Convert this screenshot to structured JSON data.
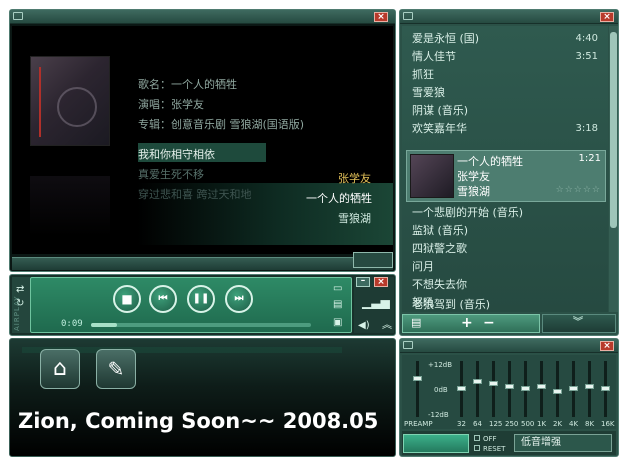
{
  "display": {
    "song_title": "歌名：一个人的牺牲",
    "singer": "演唱：张学友",
    "album": "专辑：创意音乐剧 雪狼湖(国语版)",
    "lyric_current": "我和你相守相依",
    "lyric_next1": "真爱生死不移",
    "lyric_next2": "穿过悲和喜 跨过天和地",
    "hl_artist": "张学友",
    "hl_title": "一个人的牺牲",
    "hl_album": "雪狼湖"
  },
  "playlist": {
    "items": [
      {
        "title": "爱是永恒 (国)",
        "time": "4:40"
      },
      {
        "title": "情人佳节",
        "time": "3:51"
      },
      {
        "title": "抓狂",
        "time": ""
      },
      {
        "title": "雪爱狼",
        "time": ""
      },
      {
        "title": "阴谋 (音乐)",
        "time": ""
      },
      {
        "title": "欢笑嘉年华",
        "time": "3:18"
      }
    ],
    "current": {
      "title": "一个人的牺牲",
      "artist": "张学友",
      "album": "雪狼湖",
      "time": "1:21",
      "stars": "☆☆☆☆☆"
    },
    "items_after": [
      {
        "title": "一个悲剧的开始 (音乐)"
      },
      {
        "title": "监狱 (音乐)"
      },
      {
        "title": "四狱警之歌"
      },
      {
        "title": "问月"
      },
      {
        "title": "不想失去你"
      },
      {
        "title": "怒吼"
      },
      {
        "title": "老狼驾到 (音乐)"
      }
    ],
    "add_label": "+",
    "remove_label": "−"
  },
  "controls": {
    "side_label": "AIRPLAY",
    "elapsed": "0:09",
    "progress": 0.12,
    "stop_icon": "■",
    "prev_icon": "⏮",
    "pause_icon": "❚❚",
    "next_icon": "⏭"
  },
  "eq": {
    "db_top": "+12dB",
    "db_mid": "0dB",
    "db_bot": "-12dB",
    "preamp_label": "PREAMP",
    "bands": [
      "32",
      "64",
      "125",
      "250",
      "500",
      "1K",
      "2K",
      "4K",
      "8K",
      "16K"
    ],
    "levels": [
      0.5,
      0.35,
      0.4,
      0.45,
      0.5,
      0.45,
      0.55,
      0.5,
      0.45,
      0.5
    ],
    "preamp_level": 0.3,
    "off_label": "OFF",
    "reset_label": "RESET",
    "preset": "低音增强"
  },
  "banner": {
    "text": "Zion, Coming Soon~~ 2008.05",
    "home_icon": "home-icon",
    "settings_icon": "wrench-icon"
  }
}
